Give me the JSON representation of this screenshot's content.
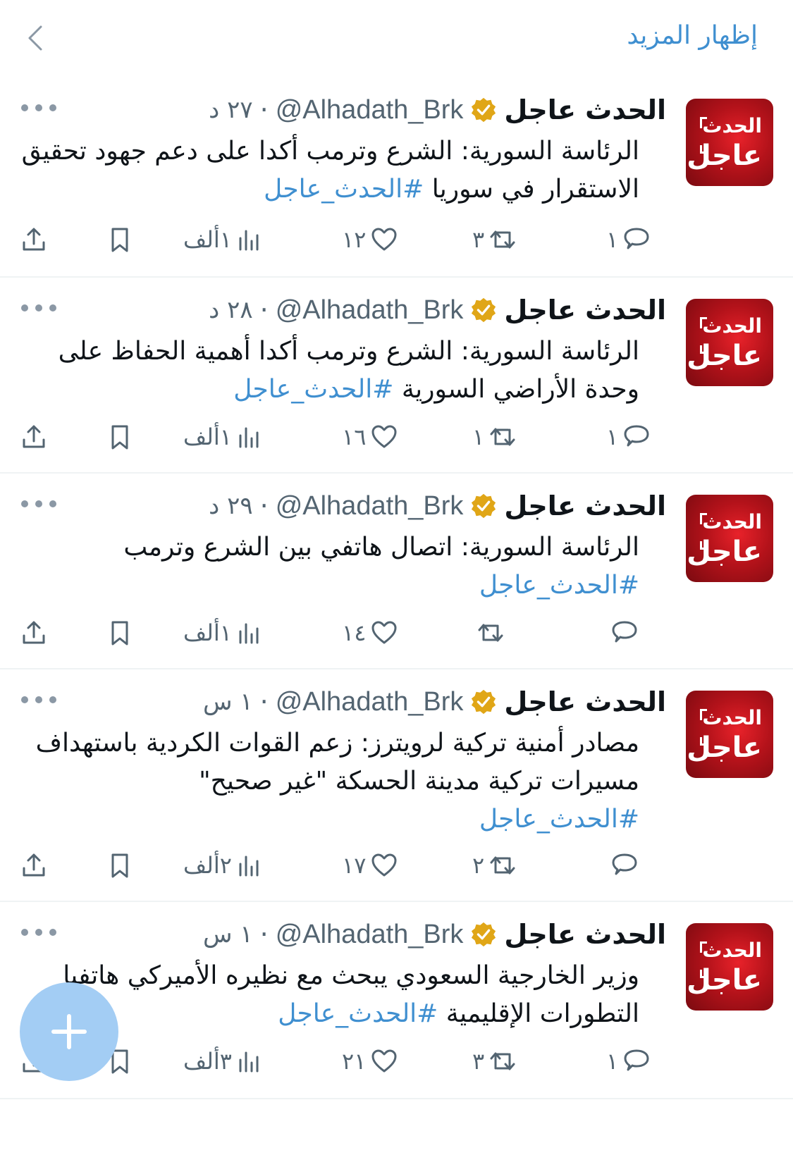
{
  "topbar": {
    "show_more": "إظهار المزيد"
  },
  "colors": {
    "accent": "#3f8fd0",
    "badge_gold": "#e0a617",
    "avatar_red": "#c4161c",
    "fab": "#a3cdf4"
  },
  "tweets": [
    {
      "author": "الحدث عاجل",
      "handle": "@Alhadath_Brk",
      "time": "٢٧ د",
      "text": "الرئاسة السورية: الشرع وترمب أكدا على دعم جهود تحقيق الاستقرار في سوريا ",
      "hashtag": "#الحدث_عاجل",
      "replies": "١",
      "retweets": "٣",
      "likes": "١٢",
      "views": "١ألف"
    },
    {
      "author": "الحدث عاجل",
      "handle": "@Alhadath_Brk",
      "time": "٢٨ د",
      "text": "الرئاسة السورية: الشرع وترمب أكدا أهمية الحفاظ على وحدة الأراضي السورية ",
      "hashtag": "#الحدث_عاجل",
      "replies": "١",
      "retweets": "١",
      "likes": "١٦",
      "views": "١ألف"
    },
    {
      "author": "الحدث عاجل",
      "handle": "@Alhadath_Brk",
      "time": "٢٩ د",
      "text": "الرئاسة السورية: اتصال هاتفي بين الشرع وترمب",
      "hashtag": "#الحدث_عاجل",
      "replies": "",
      "retweets": "",
      "likes": "١٤",
      "views": "١ألف"
    },
    {
      "author": "الحدث عاجل",
      "handle": "@Alhadath_Brk",
      "time": "١ س",
      "text": "مصادر أمنية تركية لرويترز: زعم القوات الكردية باستهداف مسيرات تركية مدينة الحسكة \"غير صحيح\"",
      "hashtag": "#الحدث_عاجل",
      "replies": "",
      "retweets": "٢",
      "likes": "١٧",
      "views": "٢ألف"
    },
    {
      "author": "الحدث عاجل",
      "handle": "@Alhadath_Brk",
      "time": "١ س",
      "text": "وزير الخارجية السعودي يبحث مع نظيره الأميركي هاتفيا التطورات الإقليمية ",
      "hashtag": "#الحدث_عاجل",
      "replies": "١",
      "retweets": "٣",
      "likes": "٢١",
      "views": "٣ألف"
    }
  ],
  "avatar": {
    "line1": "الحدث",
    "line2": "عاجل"
  },
  "icons": [
    "back-chevron-icon",
    "verified-badge-icon",
    "more-icon",
    "reply-icon",
    "retweet-icon",
    "like-icon",
    "views-icon",
    "bookmark-icon",
    "share-icon",
    "plus-icon"
  ]
}
